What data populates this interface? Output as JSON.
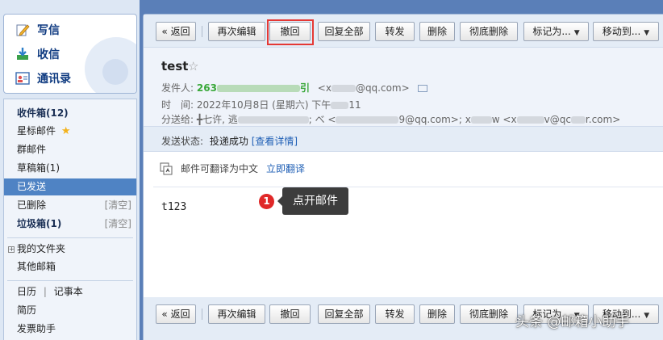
{
  "compose": {
    "write_label": "写信",
    "receive_label": "收信",
    "contacts_label": "通讯录"
  },
  "folders": {
    "inbox": "收件箱(12)",
    "starred": "星标邮件",
    "group": "群邮件",
    "drafts": "草稿箱(1)",
    "sent": "已发送",
    "deleted": "已删除",
    "deleted_clear": "[清空]",
    "junk": "垃圾箱(1)",
    "junk_clear": "[清空]",
    "my_folders": "我的文件夹",
    "other_mailbox": "其他邮箱",
    "calendar": "日历",
    "divider": "|",
    "notes": "记事本",
    "resume": "简历",
    "invoice": "发票助手"
  },
  "toolbar": {
    "back": "« 返回",
    "edit_again": "再次编辑",
    "recall": "撤回",
    "reply_all": "回复全部",
    "forward": "转发",
    "delete": "删除",
    "delete_permanently": "彻底删除",
    "mark_as": "标记为...",
    "move_to": "移动到..."
  },
  "mail": {
    "subject": "test",
    "sender_label": "发件人:",
    "sender_name": "263",
    "sender_name_tail": "引",
    "sender_email_prefix": "<x",
    "sender_email_suffix": "@qq.com>",
    "time_label": "时　间:",
    "time_value": "2022年10月8日 (星期六) 下午",
    "time_tail": "11",
    "to_label": "分送给:",
    "to_1": "╋七许, 逃",
    "to_2": "; べ <",
    "to_3": "9@qq.com>; x",
    "to_4": "w <x",
    "to_5": "v@qc",
    "to_6": "r.com>",
    "send_status_label": "发送状态:",
    "send_status_value": "投递成功",
    "view_details": "[查看详情]",
    "translate_text": "邮件可翻译为中文",
    "translate_link": "立即翻译",
    "body": "t123"
  },
  "annotation": {
    "number": "1",
    "tooltip": "点开邮件"
  },
  "watermark": "头条 @邮箱小助手",
  "colors": {
    "page_bg": "#5a7fb8",
    "selected_folder": "#4f83c4",
    "link": "#1f5fb5",
    "highlight_box": "#e53935",
    "sender_name": "#3aa83a"
  },
  "icons": [
    "pen-icon",
    "inbox-download-icon",
    "contacts-card-icon",
    "star-icon",
    "translate-icon",
    "dropdown-arrow-icon",
    "contact-card-icon"
  ]
}
